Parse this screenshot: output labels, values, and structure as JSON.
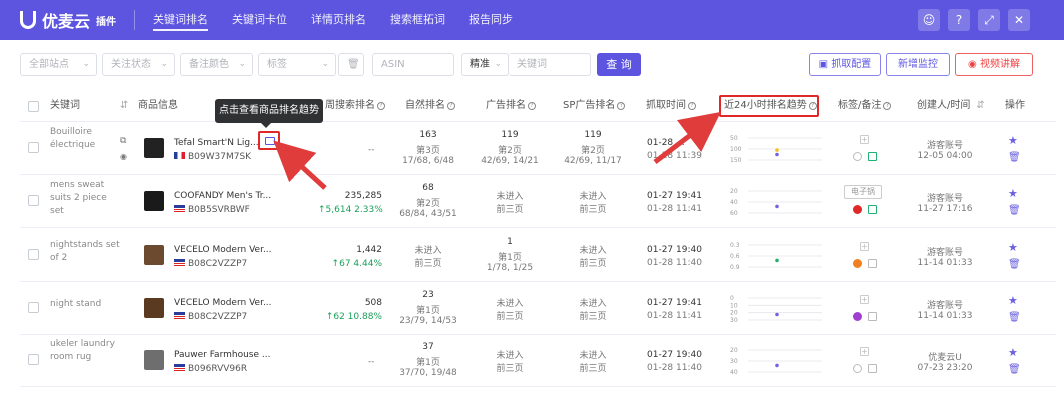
{
  "app": {
    "name": "优麦云",
    "badge": "插件"
  },
  "nav": [
    "关键词排名",
    "关键词卡位",
    "详情页排名",
    "搜索框拓词",
    "报告同步"
  ],
  "toolbar_icons": [
    "user-icon",
    "help-icon",
    "collapse-icon",
    "close-icon"
  ],
  "filters": {
    "site": "全部站点",
    "follow": "关注状态",
    "note_color": "备注颜色",
    "tag": "标签",
    "asin_placeholder": "ASIN",
    "match": "精准",
    "keyword_placeholder": "关键词",
    "query_btn": "查 询",
    "crawl_config": "抓取配置",
    "add_monitor": "新增监控",
    "video": "视频讲解"
  },
  "headers": {
    "keyword": "关键词",
    "product": "商品信息",
    "weekly_rank": "周搜索排名",
    "natural_rank": "自然排名",
    "ad_rank": "广告排名",
    "sp_ad_rank": "SP广告排名",
    "crawl_time": "抓取时间",
    "trend_24h": "近24小时排名趋势",
    "tag_note": "标签/备注",
    "creator": "创建人/时间",
    "action": "操作"
  },
  "tooltip": "点击查看商品排名趋势",
  "rows": [
    {
      "keyword": "Bouilloire électrique",
      "title": "Tefal Smart'N Lig...",
      "asin": "B09W37M7SK",
      "weekly": "--",
      "weekly_change": "",
      "weekly_pct": "",
      "natural": [
        "163",
        "第3页",
        "17/68, 6/48"
      ],
      "ad": [
        "119",
        "第2页",
        "42/69, 14/21"
      ],
      "sp": [
        "119",
        "第2页",
        "42/69, 11/17"
      ],
      "time": [
        "01-28 ...",
        "01-28 11:39"
      ],
      "trend_axis": [
        "50",
        "100",
        "150"
      ],
      "trend_marks": [
        {
          "value": 0.55,
          "color": "#f0c020"
        },
        {
          "value": 0.75,
          "color": "#7a60e0"
        }
      ],
      "creator": [
        "游客账号",
        "12-05 04:00"
      ],
      "tag": "",
      "dot_color": ""
    },
    {
      "keyword": "mens sweat suits 2 piece set",
      "title": "COOFANDY Men's Tr...",
      "asin": "B0B5SVRBWF",
      "weekly": "235,285",
      "weekly_change": "↑5,614",
      "weekly_pct": "2.33%",
      "natural": [
        "68",
        "第2页",
        "68/84, 43/51"
      ],
      "ad": [
        "未进入",
        "前三页",
        ""
      ],
      "sp": [
        "未进入",
        "前三页",
        ""
      ],
      "time": [
        "01-27 19:41",
        "01-28 11:41"
      ],
      "trend_axis": [
        "20",
        "40",
        "60"
      ],
      "trend_marks": [
        {
          "value": 0.7,
          "color": "#7a60e0"
        }
      ],
      "creator": [
        "游客账号",
        "11-27 17:16"
      ],
      "tag": "电子锅",
      "dot_color": "#e02828"
    },
    {
      "keyword": "nightstands set of 2",
      "title": "VECELO Modern Ver...",
      "asin": "B08C2VZZP7",
      "weekly": "1,442",
      "weekly_change": "↑67",
      "weekly_pct": "4.44%",
      "natural": [
        "未进入",
        "前三页",
        ""
      ],
      "ad": [
        "1",
        "第1页",
        "1/78, 1/25"
      ],
      "sp": [
        "未进入",
        "前三页",
        ""
      ],
      "time": [
        "01-27 19:40",
        "01-28 11:40"
      ],
      "trend_axis": [
        "0.3",
        "0.6",
        "0.9"
      ],
      "trend_marks": [
        {
          "value": 0.7,
          "color": "#20b070"
        }
      ],
      "creator": [
        "游客账号",
        "11-14 01:33"
      ],
      "tag": "",
      "dot_color": "#f08020"
    },
    {
      "keyword": "night stand",
      "title": "VECELO Modern Ver...",
      "asin": "B08C2VZZP7",
      "weekly": "508",
      "weekly_change": "↑62",
      "weekly_pct": "10.88%",
      "natural": [
        "23",
        "第1页",
        "23/79, 14/53"
      ],
      "ad": [
        "未进入",
        "前三页",
        ""
      ],
      "sp": [
        "未进入",
        "前三页",
        ""
      ],
      "time": [
        "01-27 19:41",
        "01-28 11:41"
      ],
      "trend_axis": [
        "0",
        "10",
        "20",
        "30"
      ],
      "trend_marks": [
        {
          "value": 0.75,
          "color": "#7a60e0"
        }
      ],
      "creator": [
        "游客账号",
        "11-14 01:33"
      ],
      "tag": "",
      "dot_color": "#a040d0"
    },
    {
      "keyword": "ukeler laundry room rug",
      "title": "Pauwer Farmhouse ...",
      "asin": "B096RVV96R",
      "weekly": "--",
      "weekly_change": "",
      "weekly_pct": "",
      "natural": [
        "37",
        "第1页",
        "37/70, 19/48"
      ],
      "ad": [
        "未进入",
        "前三页",
        ""
      ],
      "sp": [
        "未进入",
        "前三页",
        ""
      ],
      "time": [
        "01-27 19:40",
        "01-28 11:40"
      ],
      "trend_axis": [
        "20",
        "30",
        "40"
      ],
      "trend_marks": [
        {
          "value": 0.7,
          "color": "#7a60e0"
        }
      ],
      "creator": [
        "优麦云U",
        "07-23 23:20"
      ],
      "tag": "",
      "dot_color": ""
    }
  ],
  "colors": {
    "brand": "#5d55e0",
    "highlight": "#e02828"
  }
}
